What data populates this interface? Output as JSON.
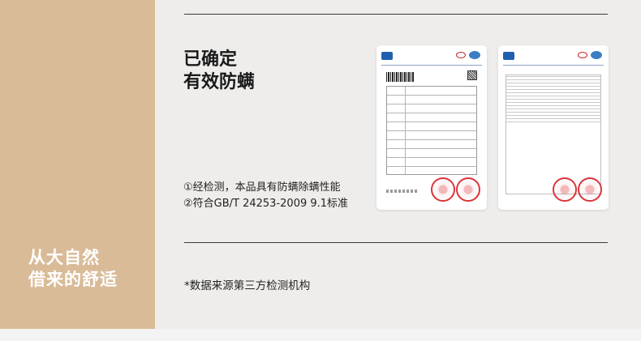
{
  "left_panel": {
    "slogan_lines": [
      "从大自然",
      "借来的舒适"
    ],
    "color": "#d9bb98"
  },
  "main": {
    "headline_lines": [
      "已确定",
      "有效防螨"
    ],
    "points": [
      "①经检测，本品具有防螨除螨性能",
      "②符合GB/T 24253-2009 9.1标准"
    ],
    "footnote": "*数据来源第三方检测机构"
  },
  "reports": [
    {
      "icon": "test-report-document-icon",
      "stamp": "red-seal-icon"
    },
    {
      "icon": "test-report-document-icon",
      "stamp": "red-seal-icon"
    }
  ]
}
